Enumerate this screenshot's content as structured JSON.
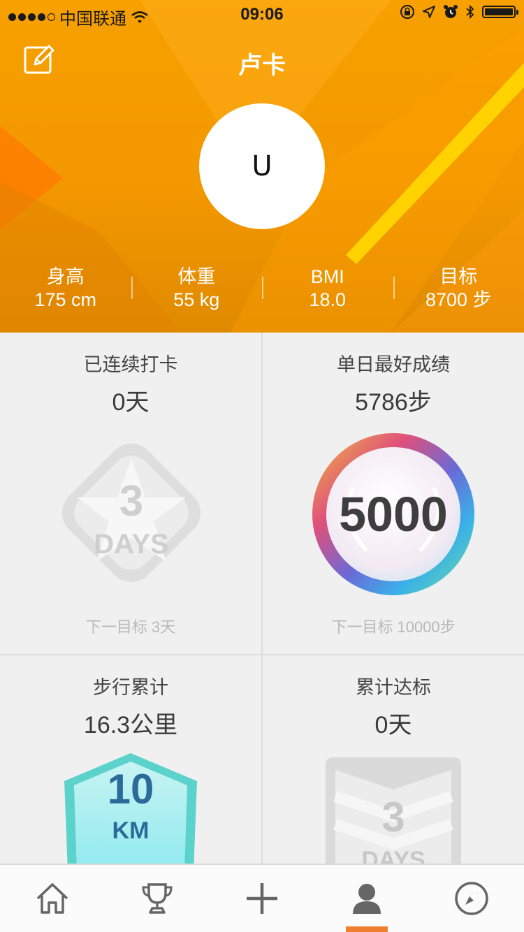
{
  "status_bar": {
    "carrier": "中国联通",
    "time": "09:06"
  },
  "header": {
    "title": "卢卡",
    "avatar_text": "U"
  },
  "stats": [
    {
      "label": "身高",
      "value": "175 cm"
    },
    {
      "label": "体重",
      "value": "55 kg"
    },
    {
      "label": "BMI",
      "value": "18.0"
    },
    {
      "label": "目标",
      "value": "8700 步"
    }
  ],
  "cards": {
    "streak": {
      "title": "已连续打卡",
      "value": "0天",
      "badge_number": "3",
      "badge_unit": "DAYS",
      "next": "下一目标  3天"
    },
    "best_day": {
      "title": "单日最好成绩",
      "value": "5786步",
      "badge_number": "5000",
      "next": "下一目标 10000步"
    },
    "walk_total": {
      "title": "步行累计",
      "value": "16.3公里",
      "badge_number": "10",
      "badge_unit": "KM"
    },
    "goal_total": {
      "title": "累计达标",
      "value": "0天",
      "badge_number": "3",
      "badge_unit": "DAYS"
    }
  },
  "tabbar": {
    "items": [
      "home-icon",
      "trophy-icon",
      "plus-icon",
      "profile-icon",
      "compass-icon"
    ],
    "active_index": 3
  },
  "colors": {
    "header_orange": "#f39800",
    "active_tab": "#f08030"
  }
}
